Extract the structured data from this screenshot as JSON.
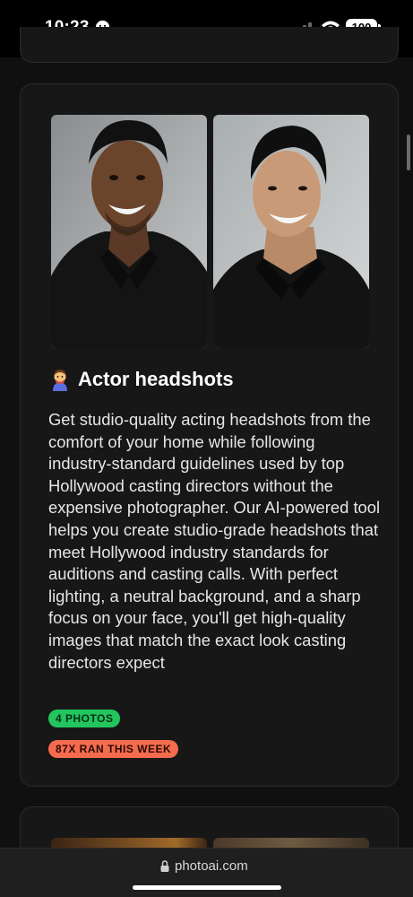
{
  "status": {
    "time": "10:23",
    "battery": "100"
  },
  "card": {
    "photos": [
      {
        "icon": "headshot-photo-man-1"
      },
      {
        "icon": "headshot-photo-man-2"
      }
    ],
    "title_icon": "actor-emoji-icon",
    "title": "Actor headshots",
    "description": "Get studio-quality acting headshots from the comfort of your home while following industry-standard guidelines used by top Hollywood casting directors without the expensive photographer. Our AI-powered tool helps you create studio-grade headshots that meet Hollywood industry standards for auditions and casting calls. With perfect lighting, a neutral background, and a sharp focus on your face, you'll get high-quality images that match the exact look casting directors expect",
    "badge_photos": "4 PHOTOS",
    "badge_runs": "87X RAN THIS WEEK",
    "colors": {
      "badge_green": "#22c55e",
      "badge_red": "#f56b4e"
    }
  },
  "browser": {
    "url": "photoai.com"
  }
}
